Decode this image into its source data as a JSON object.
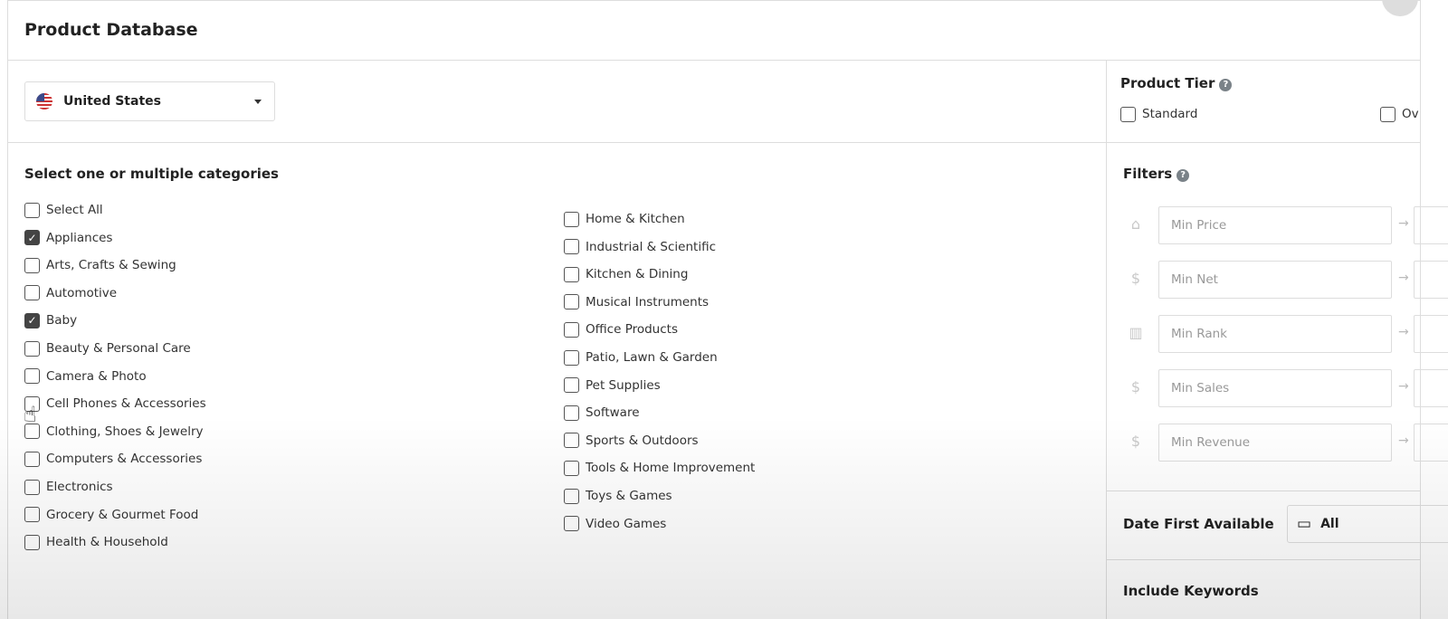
{
  "header": {
    "title": "Product Database"
  },
  "country": {
    "selected": "United States"
  },
  "categories": {
    "title": "Select one or multiple categories",
    "left": [
      {
        "label": "Select All",
        "checked": false
      },
      {
        "label": "Appliances",
        "checked": true
      },
      {
        "label": "Arts, Crafts & Sewing",
        "checked": false
      },
      {
        "label": "Automotive",
        "checked": false
      },
      {
        "label": "Baby",
        "checked": true
      },
      {
        "label": "Beauty & Personal Care",
        "checked": false
      },
      {
        "label": "Camera & Photo",
        "checked": false
      },
      {
        "label": "Cell Phones & Accessories",
        "checked": false
      },
      {
        "label": "Clothing, Shoes & Jewelry",
        "checked": false
      },
      {
        "label": "Computers & Accessories",
        "checked": false
      },
      {
        "label": "Electronics",
        "checked": false
      },
      {
        "label": "Grocery & Gourmet Food",
        "checked": false
      },
      {
        "label": "Health & Household",
        "checked": false
      }
    ],
    "right": [
      {
        "label": "Home & Kitchen",
        "checked": false
      },
      {
        "label": "Industrial & Scientific",
        "checked": false
      },
      {
        "label": "Kitchen & Dining",
        "checked": false
      },
      {
        "label": "Musical Instruments",
        "checked": false
      },
      {
        "label": "Office Products",
        "checked": false
      },
      {
        "label": "Patio, Lawn & Garden",
        "checked": false
      },
      {
        "label": "Pet Supplies",
        "checked": false
      },
      {
        "label": "Software",
        "checked": false
      },
      {
        "label": "Sports & Outdoors",
        "checked": false
      },
      {
        "label": "Tools & Home Improvement",
        "checked": false
      },
      {
        "label": "Toys & Games",
        "checked": false
      },
      {
        "label": "Video Games",
        "checked": false
      }
    ]
  },
  "product_tier": {
    "title": "Product Tier",
    "options": [
      "Standard",
      "Ov"
    ]
  },
  "filters": {
    "title": "Filters",
    "fields": [
      {
        "placeholder": "Min Price",
        "icon": "price-tag-icon",
        "glyph": "⌂"
      },
      {
        "placeholder": "Min Net",
        "icon": "money-bag-icon",
        "glyph": "$"
      },
      {
        "placeholder": "Min Rank",
        "icon": "bar-chart-icon",
        "glyph": "▥"
      },
      {
        "placeholder": "Min Sales",
        "icon": "dollar-icon",
        "glyph": "$"
      },
      {
        "placeholder": "Min Revenue",
        "icon": "revenue-cycle-icon",
        "glyph": "$"
      }
    ]
  },
  "date_first_available": {
    "label": "Date First Available",
    "value": "All"
  },
  "include_keywords": {
    "label": "Include Keywords"
  }
}
